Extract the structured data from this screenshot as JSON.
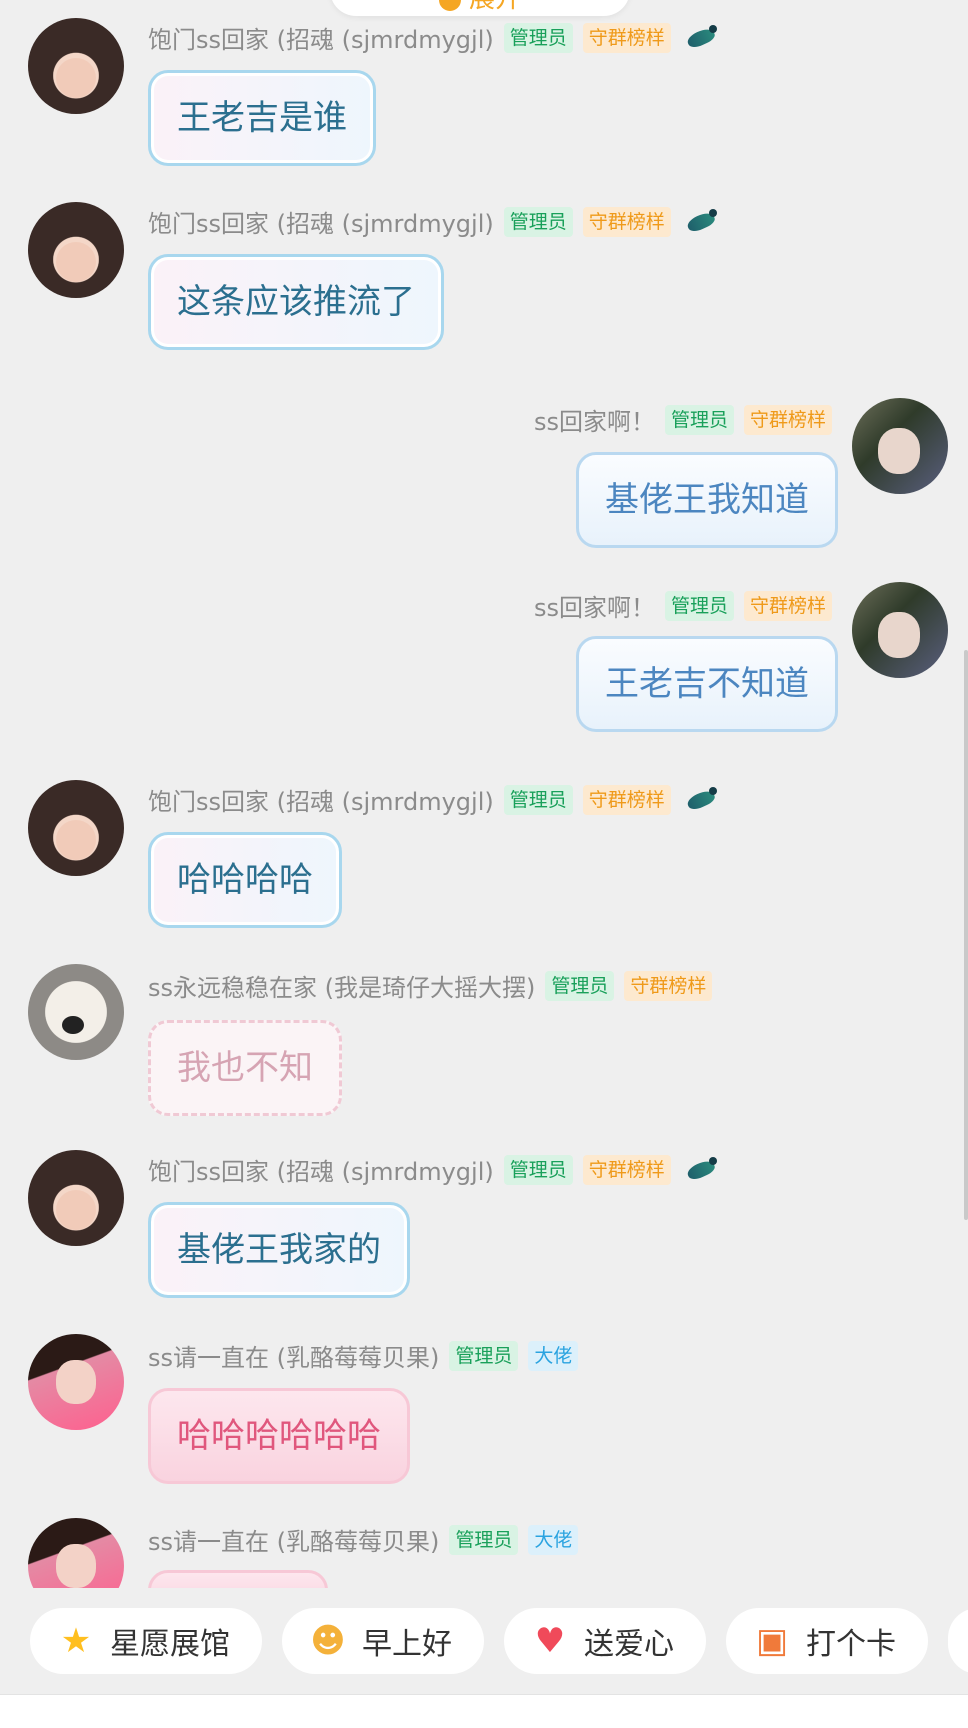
{
  "top": {
    "expand_label": "展开"
  },
  "badges": {
    "admin": "管理员",
    "guard": "守群榜样",
    "boss": "大佬"
  },
  "messages": [
    {
      "name": "饱门ss回家 (招魂 (sjmrdmygjl)",
      "text": "王老吉是谁"
    },
    {
      "name": "饱门ss回家 (招魂 (sjmrdmygjl)",
      "text": "这条应该推流了"
    },
    {
      "name": "ss回家啊！",
      "text": "基佬王我知道"
    },
    {
      "name": "ss回家啊！",
      "text": "王老吉不知道"
    },
    {
      "name": "饱门ss回家 (招魂 (sjmrdmygjl)",
      "text": "哈哈哈哈"
    },
    {
      "name": "ss永远稳稳在家 (我是琦仔大摇大摆)",
      "text": "我也不知"
    },
    {
      "name": "饱门ss回家 (招魂 (sjmrdmygjl)",
      "text": "基佬王我家的"
    },
    {
      "name": "ss请一直在 (乳酪莓莓贝果)",
      "text": "哈哈哈哈哈哈"
    },
    {
      "name": "ss请一直在 (乳酪莓莓贝果)",
      "text": ""
    }
  ],
  "quick_actions": [
    {
      "label": "星愿展馆",
      "icon": "star-icon"
    },
    {
      "label": "早上好",
      "icon": "smile-icon"
    },
    {
      "label": "送爱心",
      "icon": "heart-icon"
    },
    {
      "label": "打个卡",
      "icon": "card-icon"
    }
  ]
}
